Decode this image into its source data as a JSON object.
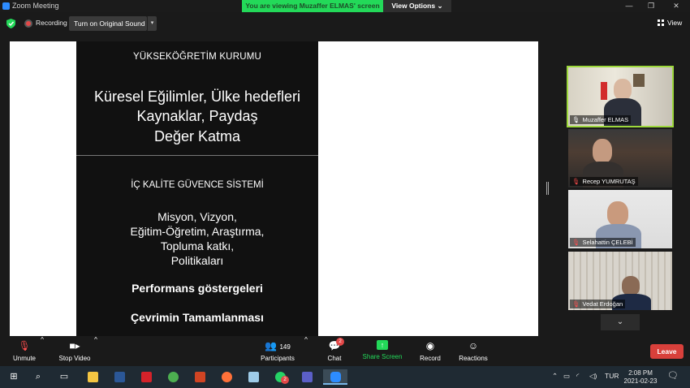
{
  "window": {
    "title": "Zoom Meeting",
    "minimize_icon": "minimize-icon",
    "maximize_icon": "maximize-icon",
    "close_icon": "close-icon"
  },
  "banner": {
    "viewing": "You are viewing Muzaffer ELMAS' screen",
    "view_options": "View Options"
  },
  "topbar": {
    "recording": "Recording",
    "original_sound": "Turn on Original Sound",
    "view": "View"
  },
  "slide": {
    "institution": "YÜKSEKÖĞRETİM KURUMU",
    "headline": [
      "Küresel Eğilimler,  Ülke hedefleri",
      "Kaynaklar, Paydaş",
      "Değer Katma"
    ],
    "system": "İÇ KALİTE GÜVENCE SİSTEMİ",
    "items": [
      "Misyon, Vizyon,",
      "Eğitim-Öğretim, Araştırma,",
      "Topluma katkı,",
      "Politikaları"
    ],
    "performance": "Performans göstergeleri",
    "cycle": "Çevrimin Tamamlanması"
  },
  "participants": [
    {
      "name": "Muzaffer ELMAS",
      "active": true,
      "mic_muted": false
    },
    {
      "name": "Recep YUMRUTAŞ",
      "active": false,
      "mic_muted": true
    },
    {
      "name": "Selahattin ÇELEBİ",
      "active": false,
      "mic_muted": true
    },
    {
      "name": "Vedat Erdoğan",
      "active": false,
      "mic_muted": true
    }
  ],
  "toolbar": {
    "unmute": "Unmute",
    "stop_video": "Stop Video",
    "participants": "Participants",
    "participants_count": "149",
    "chat": "Chat",
    "chat_badge": "2",
    "share_screen": "Share Screen",
    "record": "Record",
    "reactions": "Reactions",
    "leave": "Leave"
  },
  "taskbar": {
    "language": "TUR",
    "time": "2:08 PM",
    "date": "2021-02-23",
    "whatsapp_badge": "2"
  },
  "colors": {
    "banner_green": "#23d959",
    "active_speaker_outline": "#9dd83c",
    "leave_red": "#d8403b",
    "recording_red": "#e34848"
  }
}
